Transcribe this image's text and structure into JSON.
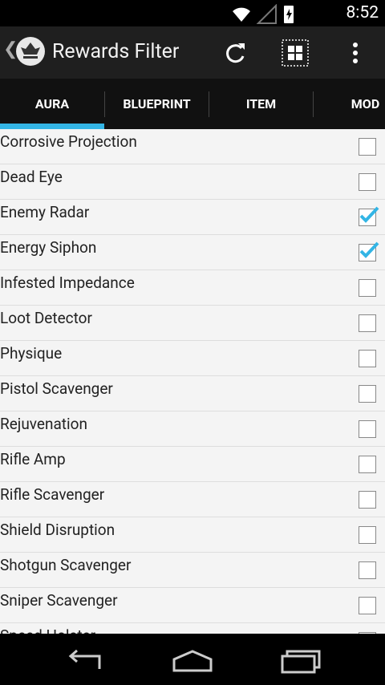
{
  "status_bar": {
    "time": "8:52"
  },
  "action_bar": {
    "title": "Rewards Filter",
    "icons": [
      "up-arrow-icon",
      "app-logo-icon",
      "refresh-icon",
      "select-all-icon",
      "overflow-menu-icon"
    ]
  },
  "tabs": [
    {
      "label": "AURA",
      "selected": true
    },
    {
      "label": "BLUEPRINT",
      "selected": false
    },
    {
      "label": "ITEM",
      "selected": false
    },
    {
      "label": "MOD",
      "selected": false
    }
  ],
  "items": [
    {
      "label": "Corrosive Projection",
      "checked": false
    },
    {
      "label": "Dead Eye",
      "checked": false
    },
    {
      "label": "Enemy Radar",
      "checked": true
    },
    {
      "label": "Energy Siphon",
      "checked": true
    },
    {
      "label": "Infested Impedance",
      "checked": false
    },
    {
      "label": "Loot Detector",
      "checked": false
    },
    {
      "label": "Physique",
      "checked": false
    },
    {
      "label": "Pistol Scavenger",
      "checked": false
    },
    {
      "label": "Rejuvenation",
      "checked": false
    },
    {
      "label": "Rifle Amp",
      "checked": false
    },
    {
      "label": "Rifle Scavenger",
      "checked": false
    },
    {
      "label": "Shield Disruption",
      "checked": false
    },
    {
      "label": "Shotgun Scavenger",
      "checked": false
    },
    {
      "label": "Sniper Scavenger",
      "checked": false
    },
    {
      "label": "Speed Holster",
      "checked": false
    }
  ],
  "colors": {
    "accent": "#33b5e5",
    "action_bar": "#1f1f1f",
    "list_bg": "#f4f4f4"
  },
  "nav_bar": {
    "icons": [
      "back-icon",
      "home-icon",
      "recents-icon"
    ]
  }
}
